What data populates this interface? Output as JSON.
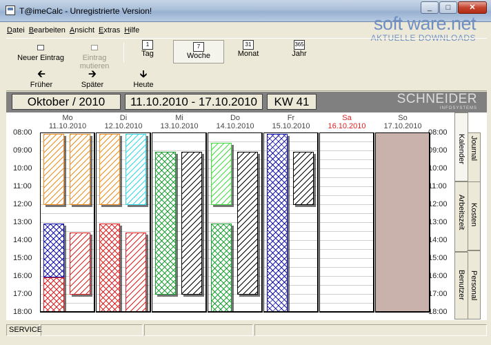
{
  "window": {
    "title": "T@imeCalc - Unregistrierte Version!",
    "buttons": [
      "_",
      "□",
      "✕"
    ]
  },
  "watermark": {
    "logo": "soft ware.net",
    "subtitle": "AKTUELLE DOWNLOADS"
  },
  "menu": [
    {
      "label": "Datei",
      "accel": "D",
      "rest": "atei"
    },
    {
      "label": "Bearbeiten",
      "accel": "B",
      "rest": "earbeiten"
    },
    {
      "label": "Ansicht",
      "accel": "A",
      "rest": "nsicht"
    },
    {
      "label": "Extras",
      "accel": "E",
      "rest": "xtras"
    },
    {
      "label": "Hilfe",
      "accel": "H",
      "rest": "ilfe"
    }
  ],
  "toolbar": {
    "new_entry": "Neuer Eintrag",
    "edit_entry": "Eintrag mutieren",
    "day": "Tag",
    "day_icon": "1",
    "week": "Woche",
    "week_icon": "7",
    "month": "Monat",
    "month_icon": "31",
    "year": "Jahr",
    "year_icon": "365",
    "earlier": "Früher",
    "later": "Später",
    "today": "Heute"
  },
  "datebar": {
    "month": "Oktober / 2010",
    "range": "11.10.2010 - 17.10.2010",
    "week": "KW 41",
    "brand": "SCHNEIDER",
    "brand_sub": "INFOSYSTEMS"
  },
  "times": [
    "08:00",
    "09:00",
    "10:00",
    "11:00",
    "12:00",
    "13:00",
    "14:00",
    "15:00",
    "16:00",
    "17:00",
    "18:00"
  ],
  "days": [
    {
      "name": "Mo",
      "date": "11.10.2010"
    },
    {
      "name": "Di",
      "date": "12.10.2010"
    },
    {
      "name": "Mi",
      "date": "13.10.2010"
    },
    {
      "name": "Do",
      "date": "14.10.2010"
    },
    {
      "name": "Fr",
      "date": "15.10.2010"
    },
    {
      "name": "Sa",
      "date": "16.10.2010",
      "color": "#e02020"
    },
    {
      "name": "So",
      "date": "17.10.2010"
    }
  ],
  "tabs": [
    "Journal",
    "Kalender",
    "Kosten",
    "Arbeitszeit",
    "Personal",
    "Benutzer"
  ],
  "status": {
    "service": "SERVICE"
  },
  "colors": {
    "orange": "#f08c1e",
    "cyan": "#30d8e8",
    "blue": "#1010b0",
    "red": "#e02020",
    "green": "#18a030",
    "lightgreen": "#40e040",
    "black": "#000000",
    "weekend": "#c8b2ab"
  }
}
